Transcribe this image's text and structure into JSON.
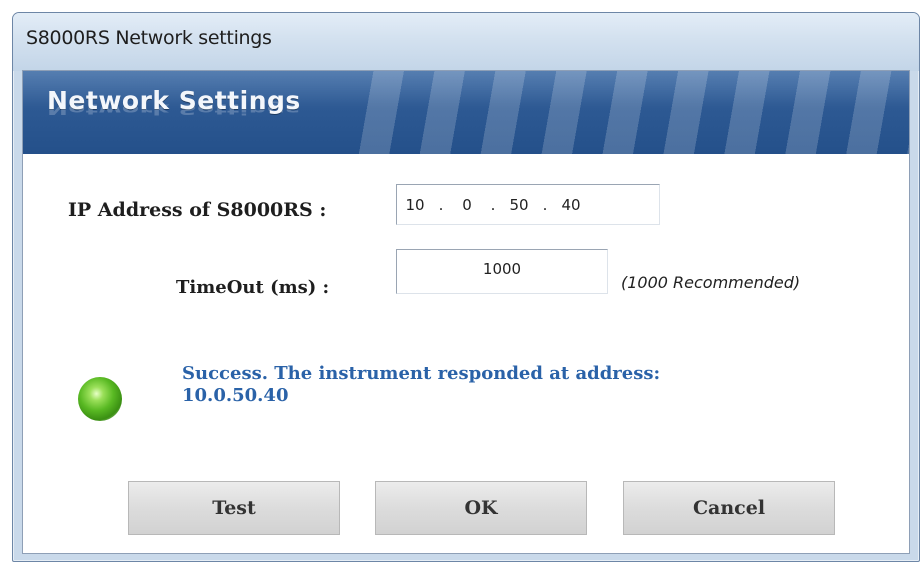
{
  "window": {
    "title": "S8000RS Network settings"
  },
  "banner": {
    "title": "Network Settings"
  },
  "ip": {
    "label": "IP Address of S8000RS :",
    "octets": [
      "10",
      "0",
      "50",
      "40"
    ],
    "separator": "."
  },
  "timeout": {
    "label": "TimeOut (ms) :",
    "value": "1000",
    "hint": "(1000 Recommended)"
  },
  "status": {
    "indicator": "green-led",
    "color": "#59b923",
    "line1": "Success. The instrument responded at address:",
    "line2": "10.0.50.40"
  },
  "buttons": {
    "test": "Test",
    "ok": "OK",
    "cancel": "Cancel"
  }
}
